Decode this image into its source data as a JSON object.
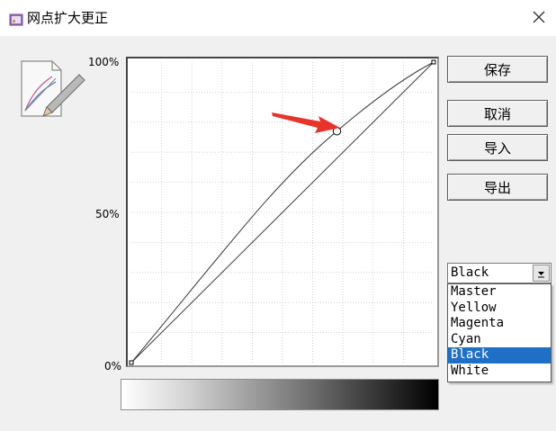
{
  "window": {
    "title": "网点扩大更正"
  },
  "curve": {
    "axis_labels": {
      "top": "100%",
      "middle": "50%",
      "bottom": "0%"
    },
    "control_point": {
      "input_pct": 68,
      "output_pct": 77
    }
  },
  "buttons": {
    "save": "保存",
    "cancel": "取消",
    "import": "导入",
    "export": "导出"
  },
  "channel_select": {
    "selected": "Black",
    "options": [
      "Master",
      "Yellow",
      "Magenta",
      "Cyan",
      "Black",
      "White"
    ]
  },
  "colors": {
    "selection": "#1f6fc6",
    "annotation_arrow": "#e8332a"
  }
}
